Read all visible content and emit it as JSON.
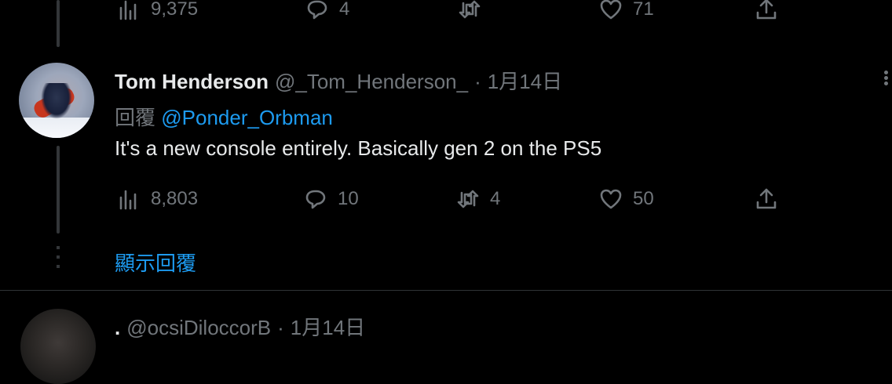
{
  "prev_tweet": {
    "views": "9,375",
    "replies": "4",
    "retweets": "",
    "likes": "71"
  },
  "tweet": {
    "name": "Tom Henderson",
    "handle": "@_Tom_Henderson_",
    "separator": "·",
    "date": "1月14日",
    "replying_prefix": "回覆",
    "replying_to": "@Ponder_Orbman",
    "text": "It's a new console entirely. Basically gen 2 on the PS5",
    "views": "8,803",
    "replies": "10",
    "retweets": "4",
    "likes": "50"
  },
  "show_replies_label": "顯示回覆",
  "next_tweet": {
    "name": ".",
    "handle": "@ocsiDiloccorB",
    "separator": "·",
    "date": "1月14日"
  },
  "icons": {
    "views": "views-chart-icon",
    "reply": "reply-bubble-icon",
    "retweet": "retweet-icon",
    "like": "heart-icon",
    "share": "share-upload-icon",
    "more": "more-dots-icon"
  },
  "colors": {
    "background": "#000000",
    "text": "#e7e9ea",
    "muted": "#71767b",
    "link": "#1d9bf0"
  }
}
